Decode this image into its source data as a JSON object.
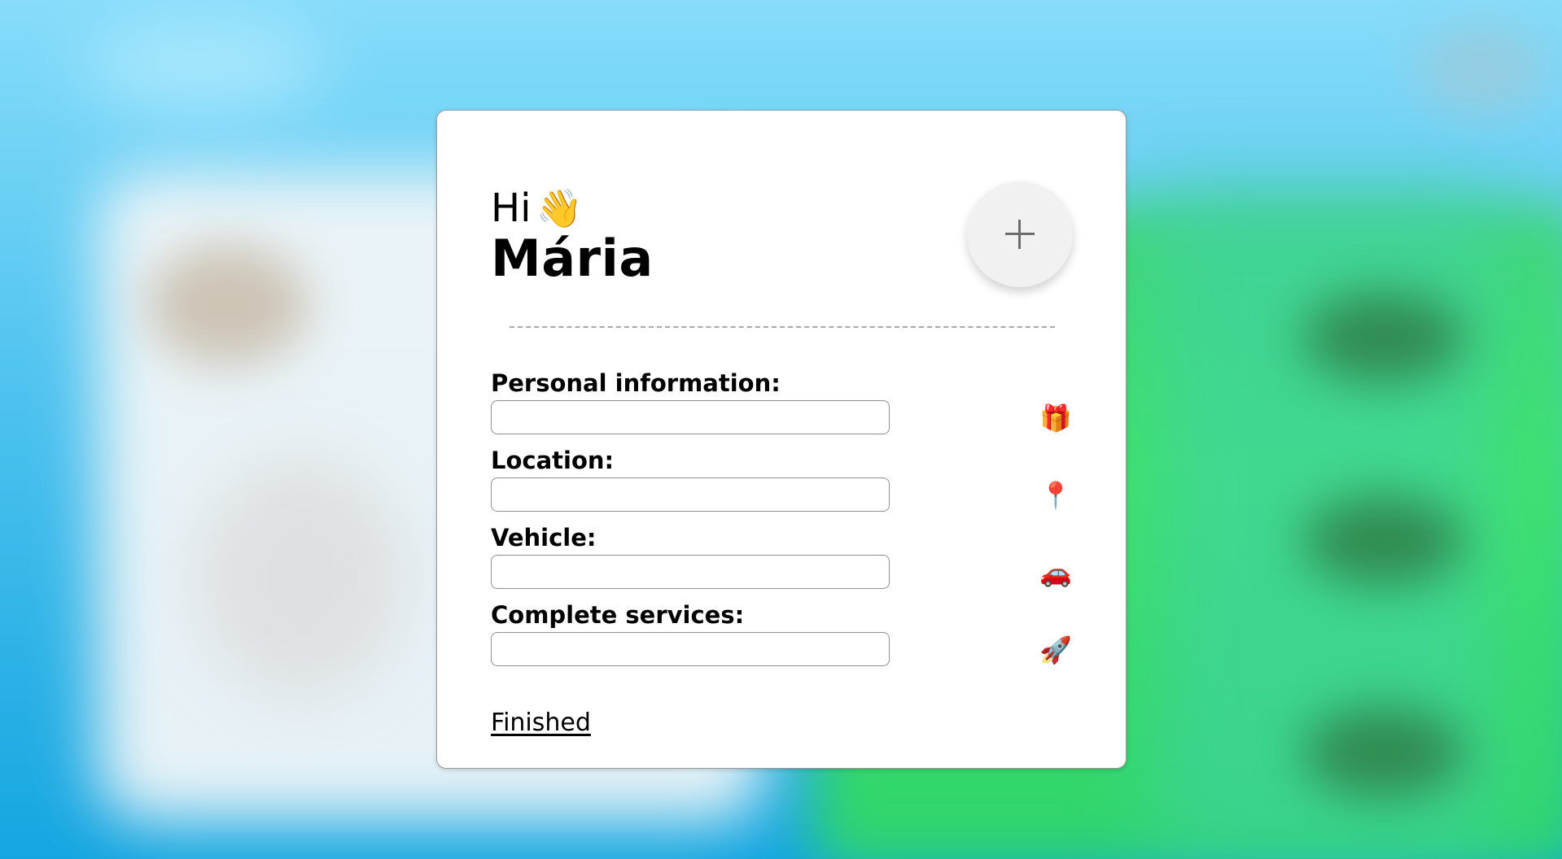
{
  "greeting": {
    "hi": "Hi",
    "wave_emoji": "👋",
    "name": "Mária"
  },
  "add_button": {
    "icon": "plus-icon",
    "label": "+"
  },
  "fields": [
    {
      "label": "Personal information:",
      "value": "",
      "placeholder": "",
      "icon": "gift-icon",
      "emoji": "🎁"
    },
    {
      "label": "Location:",
      "value": "",
      "placeholder": "",
      "icon": "pushpin-icon",
      "emoji": "📍"
    },
    {
      "label": "Vehicle:",
      "value": "",
      "placeholder": "",
      "icon": "car-icon",
      "emoji": "🚗"
    },
    {
      "label": "Complete services:",
      "value": "",
      "placeholder": "",
      "icon": "rocket-icon",
      "emoji": "🚀"
    }
  ],
  "finished_link": "Finished",
  "colors": {
    "background_top": "#86dcfa",
    "background_green": "#3ee26a",
    "card": "#ffffff",
    "button": "#f1f1f1",
    "divider": "#a9a9a9"
  }
}
